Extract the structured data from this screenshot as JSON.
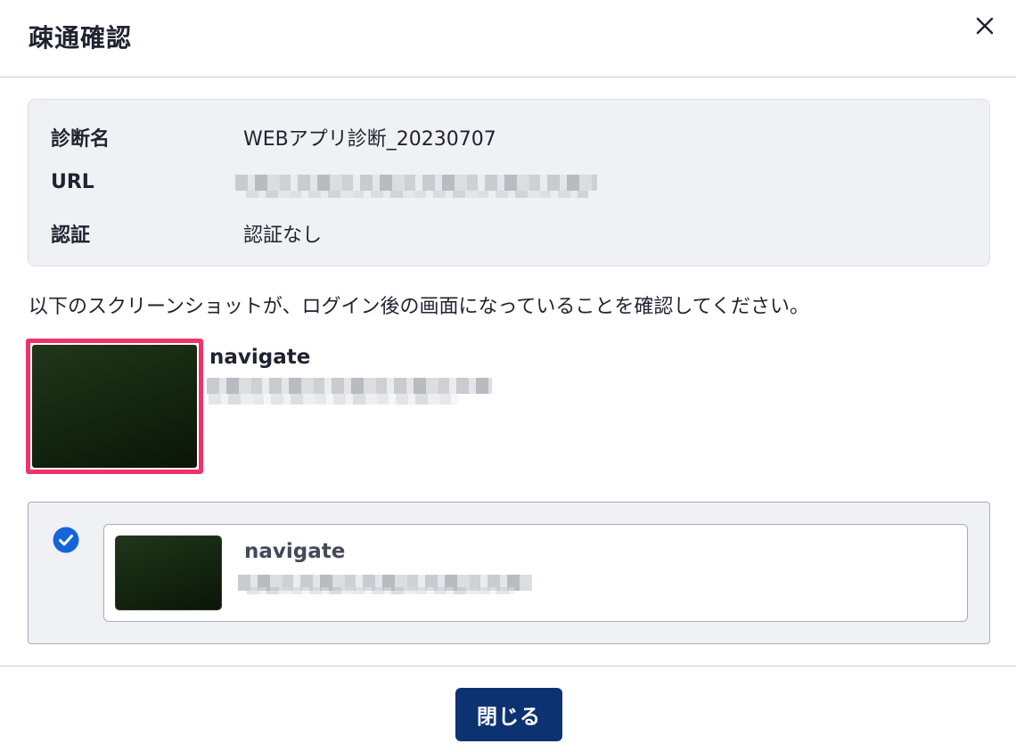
{
  "dialog": {
    "title": "疎通確認",
    "close_icon": "close-icon"
  },
  "info": {
    "rows": [
      {
        "label": "診断名",
        "value": "WEBアプリ診断_20230707"
      },
      {
        "label": "URL",
        "value": ""
      },
      {
        "label": "認証",
        "value": "認証なし"
      }
    ]
  },
  "instruction": "以下のスクリーンショットが、ログイン後の画面になっていることを確認してください。",
  "selected_screenshot": {
    "title": "navigate",
    "highlight_color": "#f0326a"
  },
  "candidates": [
    {
      "title": "navigate",
      "checked": true,
      "check_icon": "check-circle-icon"
    }
  ],
  "footer": {
    "close_label": "閉じる",
    "button_color": "#0d3272"
  }
}
